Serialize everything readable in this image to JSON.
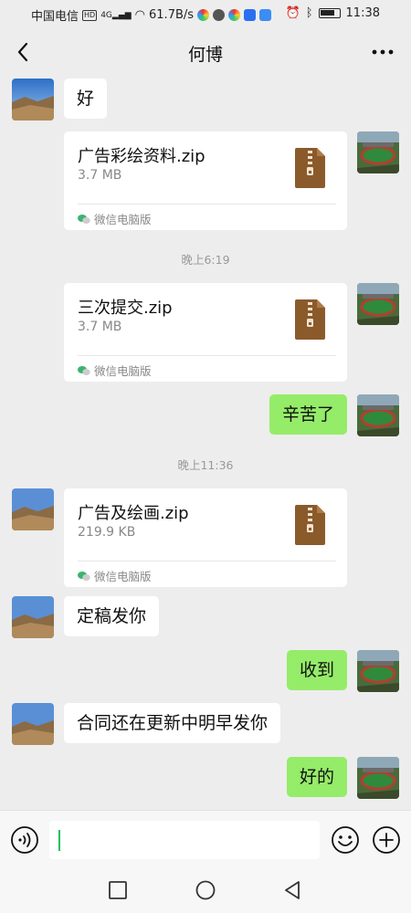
{
  "status_bar": {
    "carrier": "中国电信",
    "hd": "HD",
    "network": "4G",
    "speed": "61.7B/s",
    "time": "11:38"
  },
  "header": {
    "title": "何博"
  },
  "messages": {
    "m1": {
      "text": "好"
    },
    "f1": {
      "name": "广告彩绘资料.zip",
      "size": "3.7 MB",
      "source": "微信电脑版"
    },
    "t1": "晚上6:19",
    "f2": {
      "name": "三次提交.zip",
      "size": "3.7 MB",
      "source": "微信电脑版"
    },
    "m2": {
      "text": "辛苦了"
    },
    "t2": "晚上11:36",
    "f3": {
      "name": "广告及绘画.zip",
      "size": "219.9 KB",
      "source": "微信电脑版"
    },
    "m3": {
      "text": "定稿发你"
    },
    "m4": {
      "text": "收到"
    },
    "m5": {
      "text": "合同还在更新中明早发你"
    },
    "m6": {
      "text": "好的"
    }
  },
  "input": {
    "value": ""
  },
  "colors": {
    "bubble_green": "#95ec69",
    "background": "#ededed",
    "file_icon": "#8b5a2b",
    "caret": "#07c160"
  },
  "icons": [
    "back-arrow-icon",
    "more-icon",
    "voice-icon",
    "emoji-icon",
    "plus-icon",
    "zip-file-icon",
    "wechat-pc-icon",
    "nav-square-icon",
    "nav-circle-icon",
    "nav-triangle-icon"
  ]
}
